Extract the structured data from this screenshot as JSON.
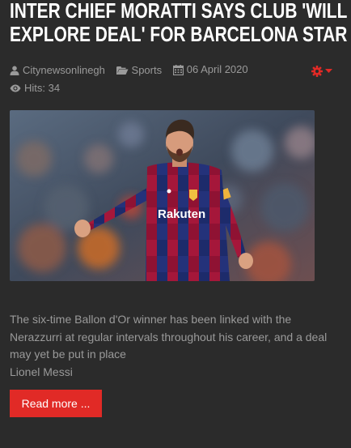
{
  "article": {
    "title_line1": "INTER CHIEF MORATTI SAYS CLUB 'WILL",
    "title_line2": "EXPLORE DEAL' FOR BARCELONA STAR",
    "author": "Citynewsonlinegh",
    "category": "Sports",
    "date": "06 April 2020",
    "hits": "Hits: 34",
    "excerpt_line1": "The six-time Ballon d'Or winner has been linked with the",
    "excerpt_line2": "Nerazzurri at regular intervals throughout his career, and a deal",
    "excerpt_line3": "may yet be put in place",
    "excerpt_line4": "Lionel Messi",
    "read_more_label": "Read more ...",
    "shirt_sponsor": "Rakuten"
  },
  "icons": {
    "author": "user-icon",
    "category": "folder-icon",
    "date": "calendar-icon",
    "hits": "eye-icon",
    "tools": "gear-icon"
  },
  "colors": {
    "background": "#2b2b2b",
    "title": "#ffffff",
    "meta_text": "#9a9a9a",
    "accent": "#e12a26"
  }
}
